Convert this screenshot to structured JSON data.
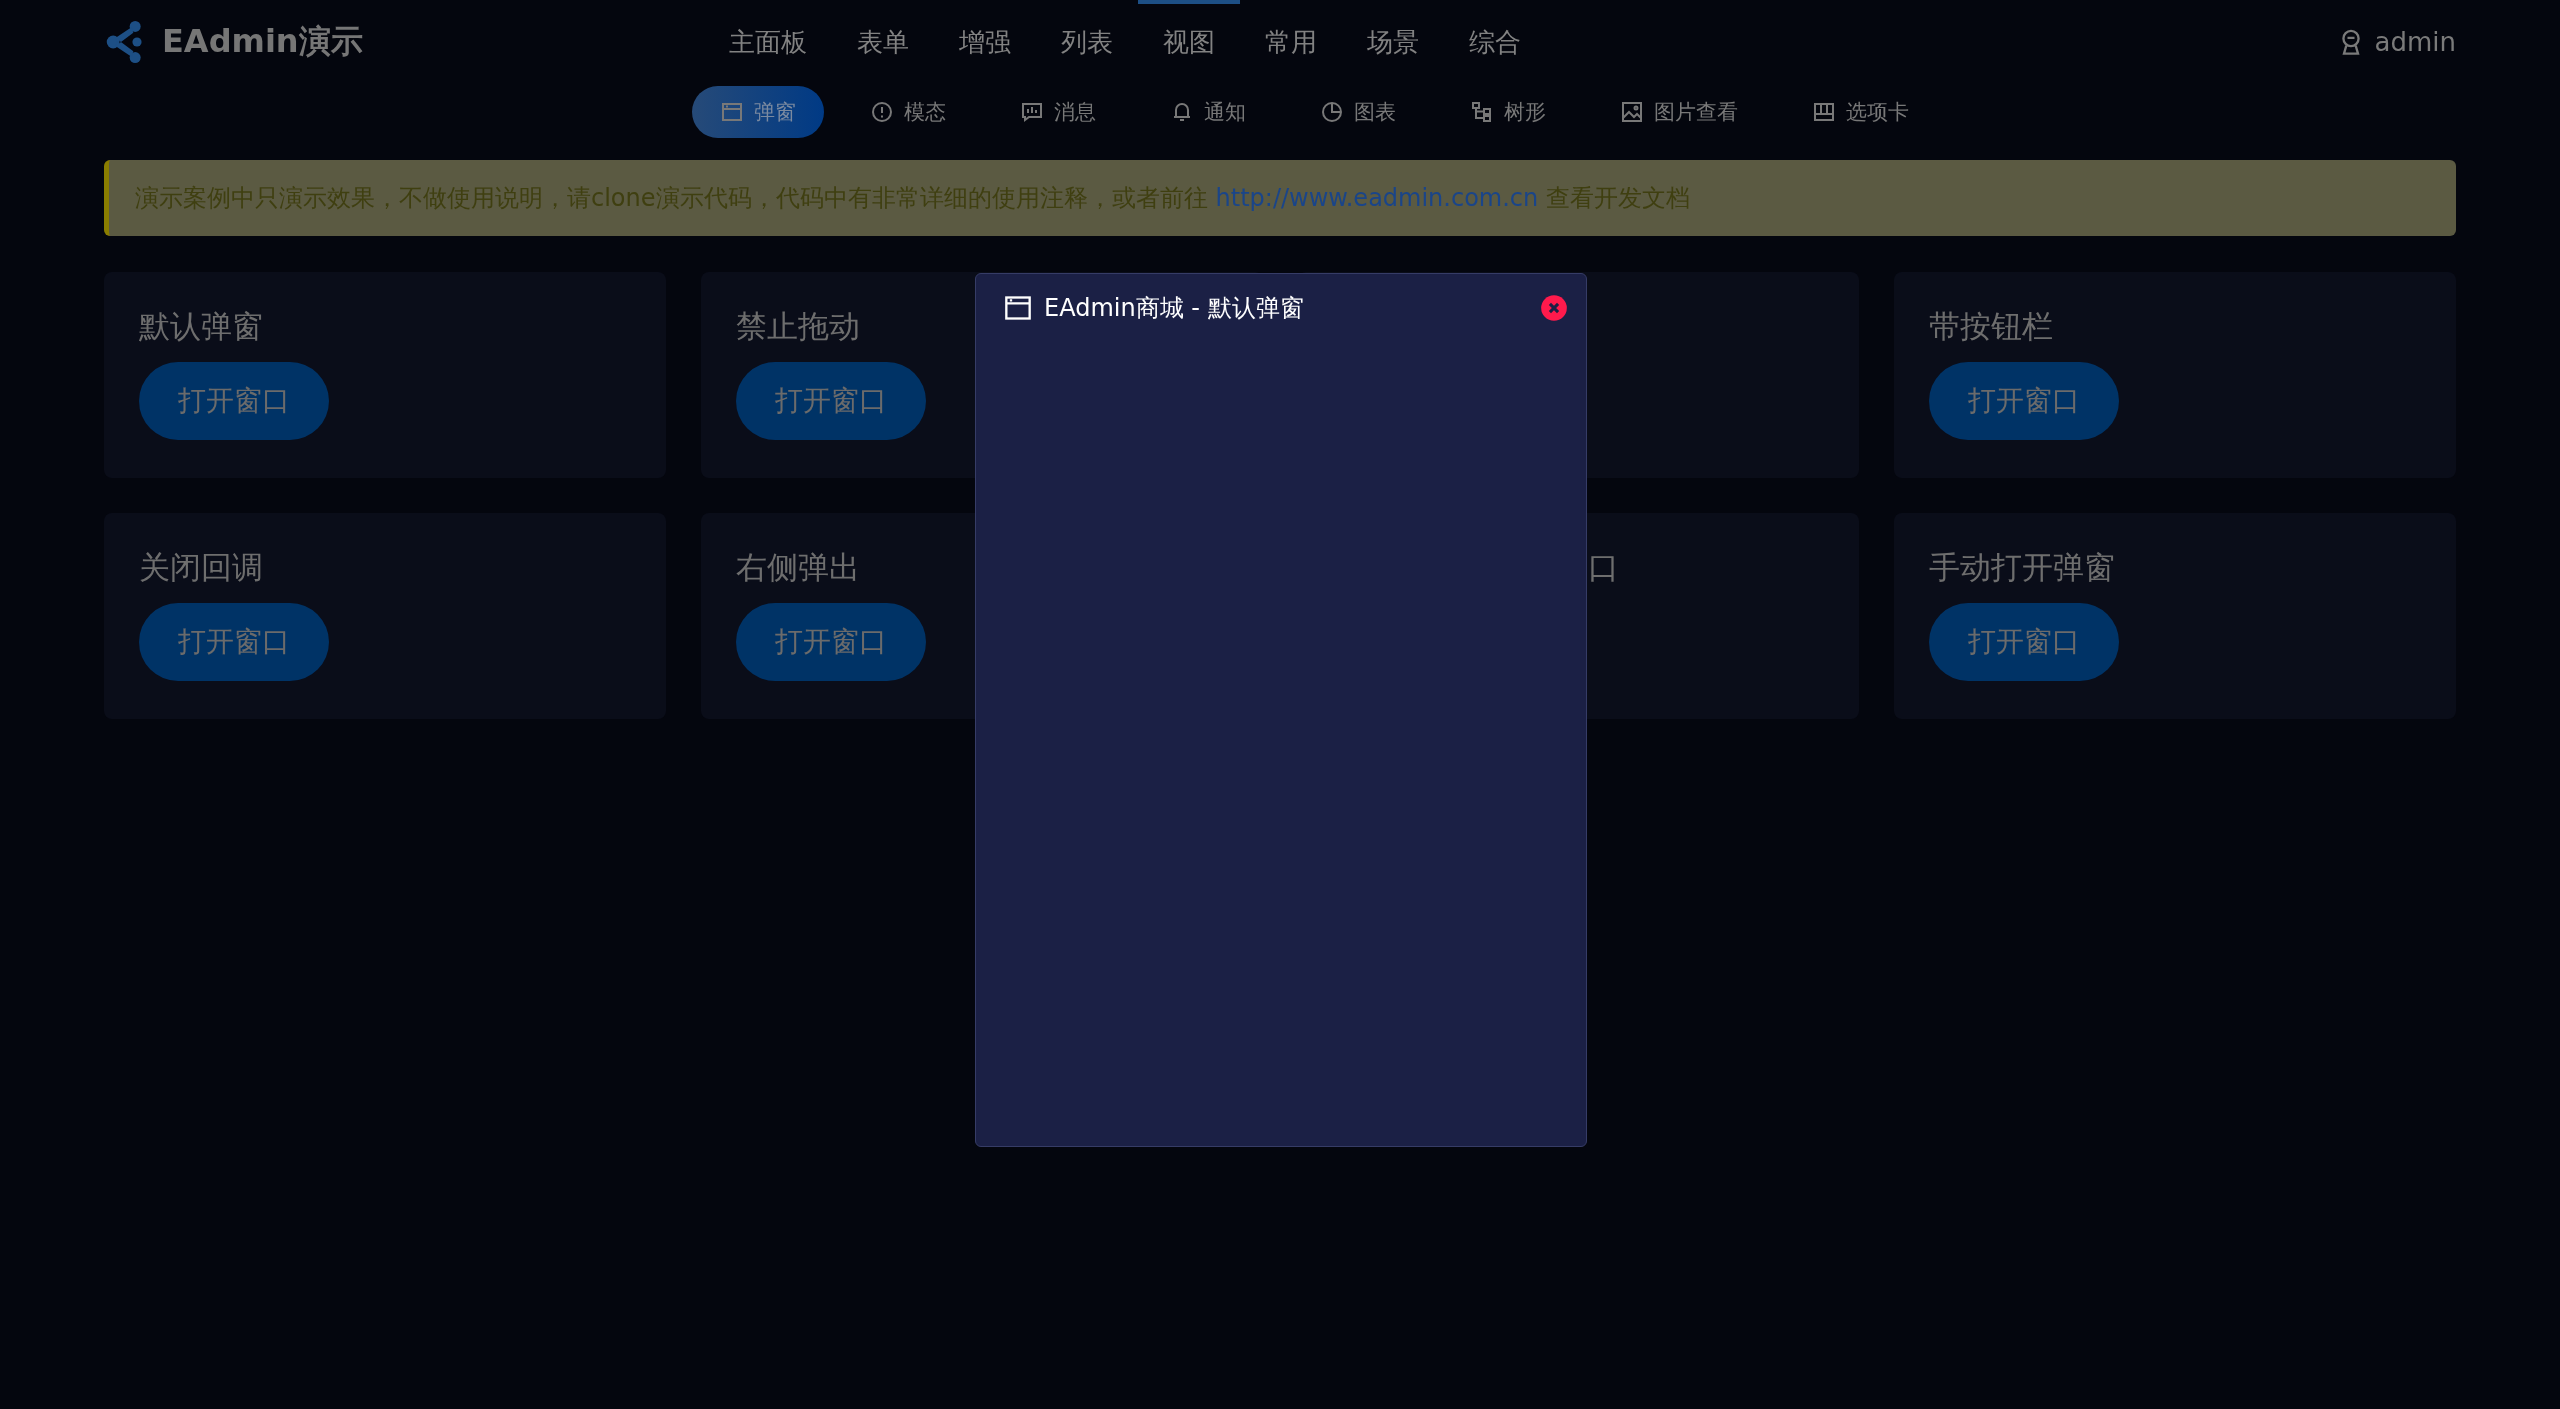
{
  "brand": "EAdmin演示",
  "nav": [
    {
      "label": "主面板",
      "selected": false
    },
    {
      "label": "表单",
      "selected": false
    },
    {
      "label": "增强",
      "selected": false
    },
    {
      "label": "列表",
      "selected": false
    },
    {
      "label": "视图",
      "selected": true
    },
    {
      "label": "常用",
      "selected": false
    },
    {
      "label": "场景",
      "selected": false
    },
    {
      "label": "综合",
      "selected": false
    }
  ],
  "user": "admin",
  "subnav": [
    {
      "label": "弹窗",
      "selected": true
    },
    {
      "label": "模态",
      "selected": false
    },
    {
      "label": "消息",
      "selected": false
    },
    {
      "label": "通知",
      "selected": false
    },
    {
      "label": "图表",
      "selected": false
    },
    {
      "label": "树形",
      "selected": false
    },
    {
      "label": "图片查看",
      "selected": false
    },
    {
      "label": "选项卡",
      "selected": false
    }
  ],
  "alert": {
    "text": "演示案例中只演示效果，不做使用说明，请clone演示代码，代码中有非常详细的使用注释，或者前往",
    "link": "http://www.eadmin.com.cn",
    "after": "查看开发文档"
  },
  "cards": [
    {
      "kind": "full",
      "title": "默认弹窗",
      "button": "打开窗口"
    },
    {
      "kind": "full",
      "title": "禁止拖动",
      "button": "打开窗口"
    },
    {
      "kind": "covered"
    },
    {
      "kind": "full",
      "title": "带按钮栏",
      "button": "打开窗口"
    },
    {
      "kind": "full",
      "title": "关闭回调",
      "button": "打开窗口"
    },
    {
      "kind": "full",
      "title": "右侧弹出",
      "button": "打开窗口"
    },
    {
      "kind": "covered",
      "title_tail": "口"
    },
    {
      "kind": "full",
      "title": "手动打开弹窗",
      "button": "打开窗口"
    }
  ],
  "dialog": {
    "title": "EAdmin商城 - 默认弹窗"
  }
}
